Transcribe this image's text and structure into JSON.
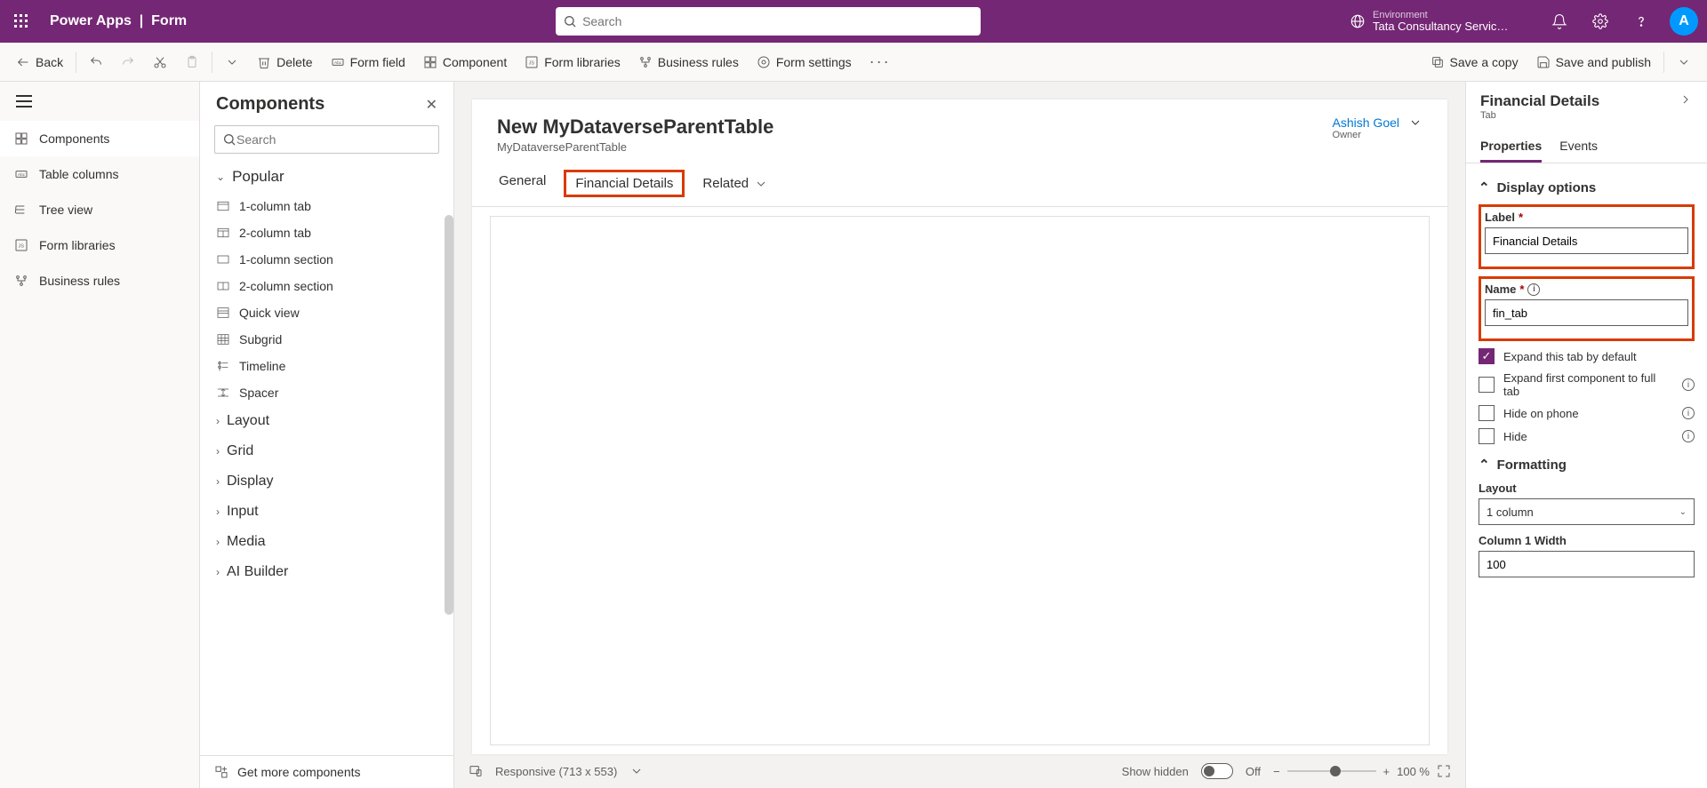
{
  "header": {
    "app": "Power Apps",
    "page": "Form",
    "search_placeholder": "Search",
    "env_label": "Environment",
    "env_name": "Tata Consultancy Servic…",
    "avatar_initial": "A"
  },
  "cmd": {
    "back": "Back",
    "delete": "Delete",
    "form_field": "Form field",
    "component": "Component",
    "form_libraries": "Form libraries",
    "business_rules": "Business rules",
    "form_settings": "Form settings",
    "save_copy": "Save a copy",
    "save_publish": "Save and publish"
  },
  "rail": {
    "components": "Components",
    "table_columns": "Table columns",
    "tree_view": "Tree view",
    "form_libraries": "Form libraries",
    "business_rules": "Business rules"
  },
  "comp": {
    "title": "Components",
    "search_placeholder": "Search",
    "popular": "Popular",
    "items": {
      "one_col_tab": "1-column tab",
      "two_col_tab": "2-column tab",
      "one_col_section": "1-column section",
      "two_col_section": "2-column section",
      "quick_view": "Quick view",
      "subgrid": "Subgrid",
      "timeline": "Timeline",
      "spacer": "Spacer"
    },
    "groups": {
      "layout": "Layout",
      "grid": "Grid",
      "display": "Display",
      "input": "Input",
      "media": "Media",
      "ai": "AI Builder"
    },
    "more": "Get more components"
  },
  "form": {
    "title": "New MyDataverseParentTable",
    "subtitle": "MyDataverseParentTable",
    "owner_name": "Ashish Goel",
    "owner_label": "Owner",
    "tabs": {
      "general": "General",
      "financial": "Financial Details",
      "related": "Related"
    }
  },
  "footer": {
    "responsive": "Responsive (713 x 553)",
    "show_hidden": "Show hidden",
    "off": "Off",
    "zoom": "100 %"
  },
  "props": {
    "title": "Financial Details",
    "type": "Tab",
    "tabs": {
      "properties": "Properties",
      "events": "Events"
    },
    "display_options": "Display options",
    "label_label": "Label",
    "label_value": "Financial Details",
    "name_label": "Name",
    "name_value": "fin_tab",
    "expand_default": "Expand this tab by default",
    "expand_first": "Expand first component to full tab",
    "hide_phone": "Hide on phone",
    "hide": "Hide",
    "formatting": "Formatting",
    "layout_label": "Layout",
    "layout_value": "1 column",
    "col1_width_label": "Column 1 Width",
    "col1_width_value": "100"
  }
}
